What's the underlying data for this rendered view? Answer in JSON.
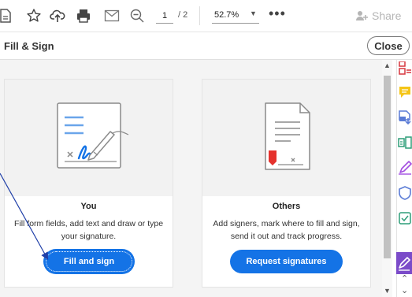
{
  "toolbar": {
    "icons": [
      "create-pdf-icon",
      "bookmark-star-icon",
      "upload-icon",
      "print-icon",
      "email-icon",
      "zoom-out-icon"
    ],
    "page_current": "1",
    "page_total": "/ 2",
    "zoom_value": "52.7%",
    "more_label": "•••",
    "share_label": "Share"
  },
  "panel": {
    "title": "Fill & Sign",
    "close_label": "Close"
  },
  "cards": [
    {
      "title": "You",
      "description": "Fill form fields, add text and draw or type your signature.",
      "button_label": "Fill and sign"
    },
    {
      "title": "Others",
      "description": "Add signers, mark where to fill and sign, send it out and track progress.",
      "button_label": "Request signatures"
    }
  ],
  "right_rail": {
    "icons": [
      "organize-pages-icon",
      "comment-icon",
      "export-pdf-icon",
      "edit-pdf-icon",
      "fill-sign-pen-icon",
      "protect-shield-icon",
      "send-for-review-icon",
      "fill-sign-active-icon"
    ]
  },
  "colors": {
    "accent_blue": "#1473e6",
    "rail_active": "#7b4bc9",
    "annotation_arrow": "#1f3fa8"
  }
}
